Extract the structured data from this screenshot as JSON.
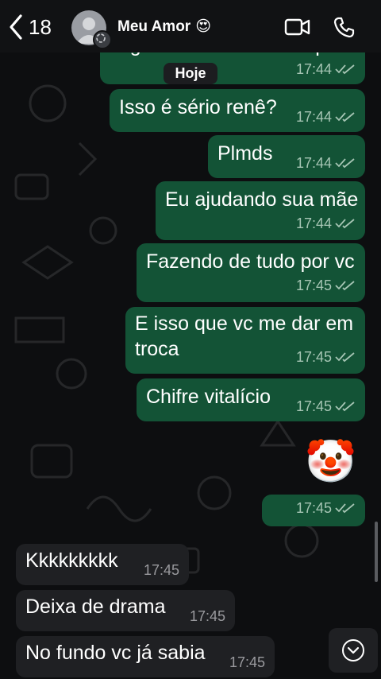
{
  "header": {
    "back_count": "18",
    "contact_name": "Meu Amor",
    "contact_emoji": "😍",
    "icons": [
      "chevron-left-icon",
      "video-call-icon",
      "phone-icon"
    ]
  },
  "date_label": "Hoje",
  "messages": [
    {
      "direction": "outgoing",
      "text": "enganou todo esse tempo?",
      "time": "17:44",
      "status": "read"
    },
    {
      "direction": "outgoing",
      "text": "Isso é sério renê?",
      "time": "17:44",
      "status": "read"
    },
    {
      "direction": "outgoing",
      "text": "Plmds",
      "time": "17:44",
      "status": "read"
    },
    {
      "direction": "outgoing",
      "text": "Eu ajudando sua mãe",
      "time": "17:44",
      "status": "read"
    },
    {
      "direction": "outgoing",
      "text": "Fazendo de tudo por vc",
      "time": "17:45",
      "status": "read"
    },
    {
      "direction": "outgoing",
      "text_line1": "E isso que vc me dar em",
      "text_line2": "troca",
      "time": "17:45",
      "status": "read"
    },
    {
      "direction": "outgoing",
      "text": "Chifre vitalício",
      "time": "17:45",
      "status": "read"
    },
    {
      "direction": "outgoing",
      "emoji": "🤡"
    },
    {
      "direction": "outgoing",
      "time": "17:45",
      "status": "read"
    },
    {
      "direction": "incoming",
      "text": "Kkkkkkkkk",
      "time": "17:45"
    },
    {
      "direction": "incoming",
      "text": "Deixa de drama",
      "time": "17:45"
    },
    {
      "direction": "incoming",
      "text": "No fundo vc já sabia",
      "time": "17:45"
    }
  ],
  "colors": {
    "outgoing_bubble": "#135336",
    "incoming_bubble": "#1f2023",
    "background": "#0d0e10",
    "read_ticks": "#a6c5b4"
  }
}
